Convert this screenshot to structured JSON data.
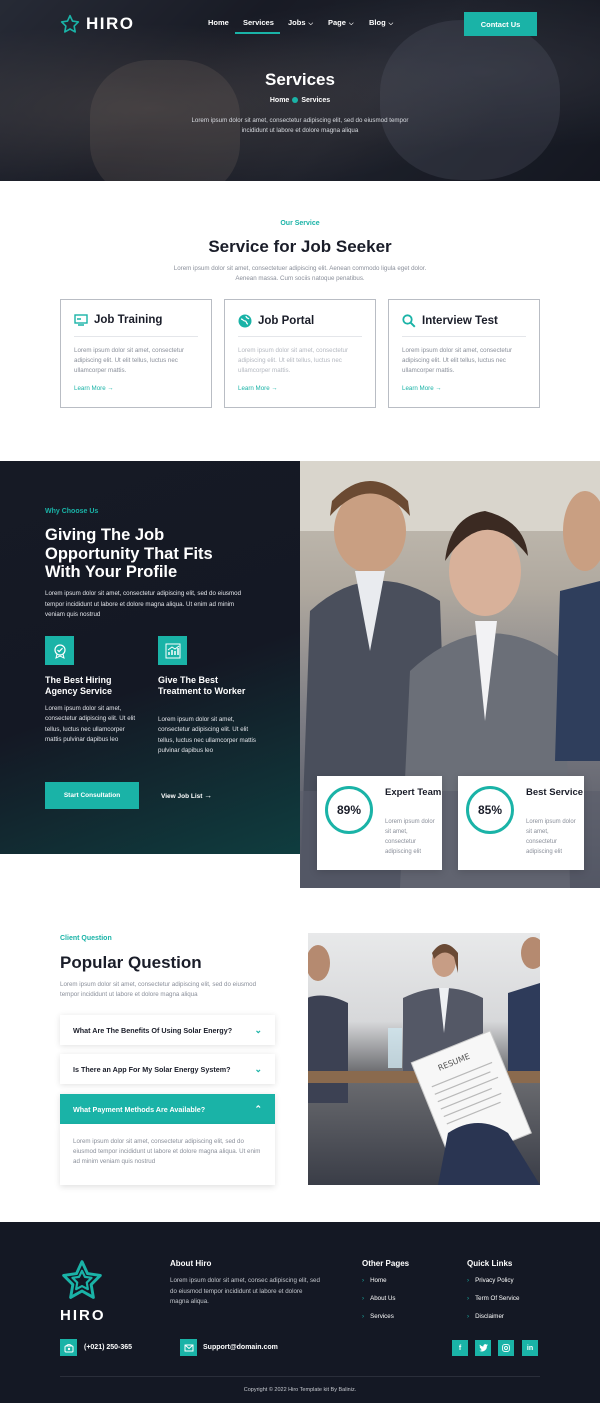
{
  "brand": {
    "name": "HIRO",
    "accent": "#1ab3a7",
    "dark": "#141824"
  },
  "nav": {
    "items": [
      "Home",
      "Services",
      "Jobs",
      "Page",
      "Blog"
    ],
    "active": "Services",
    "cta": "Contact Us"
  },
  "hero": {
    "title": "Services",
    "crumb_home": "Home",
    "crumb_current": "Services",
    "desc": "Lorem ipsum dolor sit amet, consectetur adipiscing elit, sed do eiusmod tempor incididunt ut labore et dolore magna aliqua"
  },
  "service": {
    "eyebrow": "Our Service",
    "title": "Service for Job Seeker",
    "desc": "Lorem ipsum dolor sit amet, consectetuer adipiscing elit. Aenean commodo ligula eget dolor. Aenean massa. Cum sociis natoque penatibus.",
    "cards": [
      {
        "title": "Job Training",
        "icon": "training-icon",
        "desc": "Lorem ipsum dolor sit amet, consectetur adipiscing elit. Ut elit tellus, luctus nec ullamcorper mattis.",
        "link": "Learn More"
      },
      {
        "title": "Job Portal",
        "icon": "globe-icon",
        "desc": "Lorem ipsum dolor sit amet, consectetur adipiscing elit. Ut elit tellus, luctus nec ullamcorper mattis.",
        "link": "Learn More"
      },
      {
        "title": "Interview Test",
        "icon": "search-icon",
        "desc": "Lorem ipsum dolor sit amet, consectetur adipiscing elit. Ut elit tellus, luctus nec ullamcorper mattis.",
        "link": "Learn More"
      }
    ]
  },
  "why": {
    "eyebrow": "Why Choose Us",
    "title": "Giving The Job Opportunity That Fits With Your Profile",
    "desc": "Lorem ipsum dolor sit amet, consectetur adipiscing elit, sed do eiusmod tempor incididunt ut labore et dolore magna aliqua. Ut enim ad minim veniam quis nostrud",
    "features": [
      {
        "title": "The Best Hiring Agency Service",
        "desc": "Lorem ipsum dolor sit amet, consectetur adipiscing elit. Ut elit tellus, luctus nec ullamcorper mattis pulvinar dapibus leo"
      },
      {
        "title": "Give The Best Treatment to Worker",
        "desc": "Lorem ipsum dolor sit amet, consectetur adipiscing elit. Ut elit tellus, luctus nec ullamcorper mattis pulvinar dapibus leo"
      }
    ],
    "btn_primary": "Start Consultation",
    "btn_secondary": "View Job List",
    "stats": [
      {
        "value": "89%",
        "title": "Expert Team",
        "desc": "Lorem ipsum dolor sit amet, consectetur adipiscing elit"
      },
      {
        "value": "85%",
        "title": "Best Service",
        "desc": "Lorem ipsum dolor sit amet, consectetur adipiscing elit"
      }
    ]
  },
  "faq": {
    "eyebrow": "Client Question",
    "title": "Popular Question",
    "desc": "Lorem ipsum dolor sit amet, consectetur adipiscing elit, sed do eiusmod tempor incididunt ut labore et dolore magna aliqua",
    "items": [
      "What Are The Benefits Of Using Solar Energy?",
      "Is There an App For My Solar Energy System?",
      "What Payment Methods Are Available?"
    ],
    "answer": "Lorem ipsum dolor sit amet, consectetur adipiscing elit, sed do eiusmod tempor incididunt ut labore et dolore magna aliqua. Ut enim ad minim veniam quis nostrud"
  },
  "footer": {
    "about_title": "About Hiro",
    "about_text": "Lorem ipsum dolor sit amet, consec adipiscing elit, sed do eiusmod tempor incididunt ut labore et dolore magna aliqua.",
    "other_title": "Other Pages",
    "other_links": [
      "Home",
      "About Us",
      "Services"
    ],
    "quick_title": "Quick Links",
    "quick_links": [
      "Privacy Policy",
      "Term Of Service",
      "Disclaimer"
    ],
    "phone": "(+021) 250-365",
    "email": "Support@domain.com",
    "social": [
      "f",
      "t",
      "ig",
      "in"
    ],
    "copyright": "Copyright © 2022 Hiro Template kit By Baliniz."
  }
}
